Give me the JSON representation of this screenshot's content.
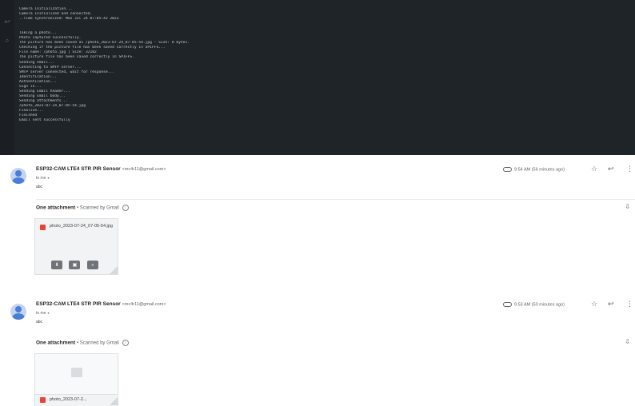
{
  "terminal": {
    "lines": [
      "Camera initialization...",
      "Camera initialized and connected.",
      "..Time synchronized: Mon Jul 24 07:05:43 2023",
      "",
      "",
      "Taking a photo...",
      "Photo captured successfully.",
      "The picture has been saved as /photo_2023-07-24_07-05-54.jpg - Size: 0 bytes.",
      "Checking if the picture file has been saved correctly in SPIFFS...",
      "File name: /photo.jpg | Size: 32182",
      "The picture file has been saved correctly in SPIFFS.",
      "Sending email...",
      "Connecting to SMTP server...",
      "SMTP server connected, wait for response...",
      "Identification...",
      "Authentication...",
      "Sign in...",
      "Sending Email header...",
      "Sending Email body...",
      "Sending attachments...",
      "/photo_2023-07-24_07-05-54.jpg",
      "Finalize...",
      "Finished",
      "Email sent successfully"
    ]
  },
  "emails": [
    {
      "sender_name": "ESP32-CAM LTE4 STR PIR Sensor",
      "sender_email": "<mc4r11@gmail.com>",
      "to": "to me",
      "snippet": "abc",
      "time": "9:54 AM (56 minutes ago)",
      "attachment_header": "One attachment",
      "scanned": "Scanned by Gmail",
      "file_name": "photo_2023-07-24_07-05-54.jpg"
    },
    {
      "sender_name": "ESP32-CAM LTE4 STR PIR Sensor",
      "sender_email": "<mc4r11@gmail.com>",
      "to": "to me",
      "snippet": "abc",
      "time": "9:53 AM (50 minutes ago)",
      "attachment_header": "One attachment",
      "scanned": "Scanned by Gmail",
      "file_name": "photo_2023-07-2..."
    }
  ],
  "icons": {
    "star": "☆",
    "reply": "↩",
    "more": "⋮",
    "drive": "⇩",
    "download": "⬇",
    "image": "▣",
    "search": "⌕",
    "info": "i",
    "caret": "▾"
  },
  "colors": {
    "terminal_bg": "#1f2428",
    "pdf_red": "#ea4335",
    "avatar_blue": "#4a7dd7"
  }
}
